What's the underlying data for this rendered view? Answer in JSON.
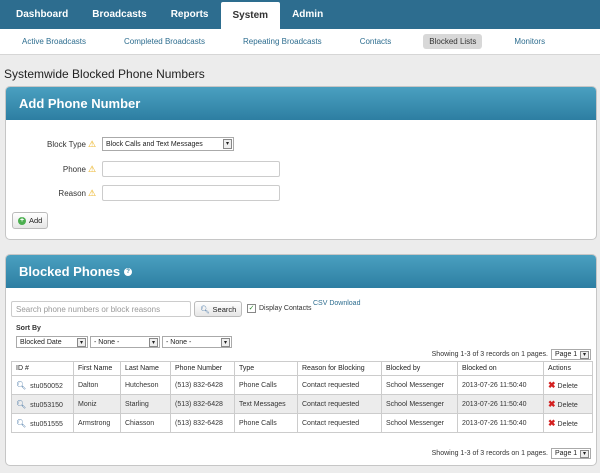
{
  "nav": {
    "tabs": [
      {
        "label": "Dashboard"
      },
      {
        "label": "Broadcasts"
      },
      {
        "label": "Reports"
      },
      {
        "label": "System"
      },
      {
        "label": "Admin"
      }
    ],
    "active_tab": "System"
  },
  "subnav": {
    "items": [
      {
        "label": "Active Broadcasts"
      },
      {
        "label": "Completed Broadcasts"
      },
      {
        "label": "Repeating Broadcasts"
      },
      {
        "label": "Contacts"
      },
      {
        "label": "Blocked Lists"
      },
      {
        "label": "Monitors"
      }
    ],
    "active": "Blocked Lists"
  },
  "page_title": "Systemwide Blocked Phone Numbers",
  "add_panel": {
    "title": "Add Phone Number",
    "block_type_label": "Block Type",
    "block_type_value": "Block Calls and Text Messages",
    "phone_label": "Phone",
    "phone_value": "",
    "reason_label": "Reason",
    "reason_value": "",
    "add_button": "Add"
  },
  "blocked_panel": {
    "title": "Blocked Phones",
    "search_placeholder": "Search phone numbers or block reasons",
    "search_button": "Search",
    "display_contacts_label": "Display Contacts",
    "display_contacts_checked": true,
    "csv_link": "CSV Download",
    "sort_by_label": "Sort By",
    "sort_selects": [
      "Blocked Date",
      "- None -",
      "- None -"
    ],
    "paging_text": "Showing 1-3 of 3 records on 1 pages.",
    "page_select": "Page 1",
    "columns": [
      "ID #",
      "First Name",
      "Last Name",
      "Phone Number",
      "Type",
      "Reason for Blocking",
      "Blocked by",
      "Blocked on",
      "Actions"
    ],
    "rows": [
      {
        "id": "stu050052",
        "first": "Dalton",
        "last": "Hutcheson",
        "phone": "(513) 832-6428",
        "type": "Phone Calls",
        "reason": "Contact requested",
        "by": "School Messenger",
        "on": "2013-07-26 11:50:40",
        "action": "Delete"
      },
      {
        "id": "stu053150",
        "first": "Moniz",
        "last": "Starling",
        "phone": "(513) 832-6428",
        "type": "Text Messages",
        "reason": "Contact requested",
        "by": "School Messenger",
        "on": "2013-07-26 11:50:40",
        "action": "Delete"
      },
      {
        "id": "stu051555",
        "first": "Armstrong",
        "last": "Chiasson",
        "phone": "(513) 832-6428",
        "type": "Phone Calls",
        "reason": "Contact requested",
        "by": "School Messenger",
        "on": "2013-07-26 11:50:40",
        "action": "Delete"
      }
    ]
  },
  "colors": {
    "nav_bg": "#2d6d8f",
    "panel_head": "#3a93b6",
    "link": "#2d6d8f",
    "delete": "#d42020"
  }
}
